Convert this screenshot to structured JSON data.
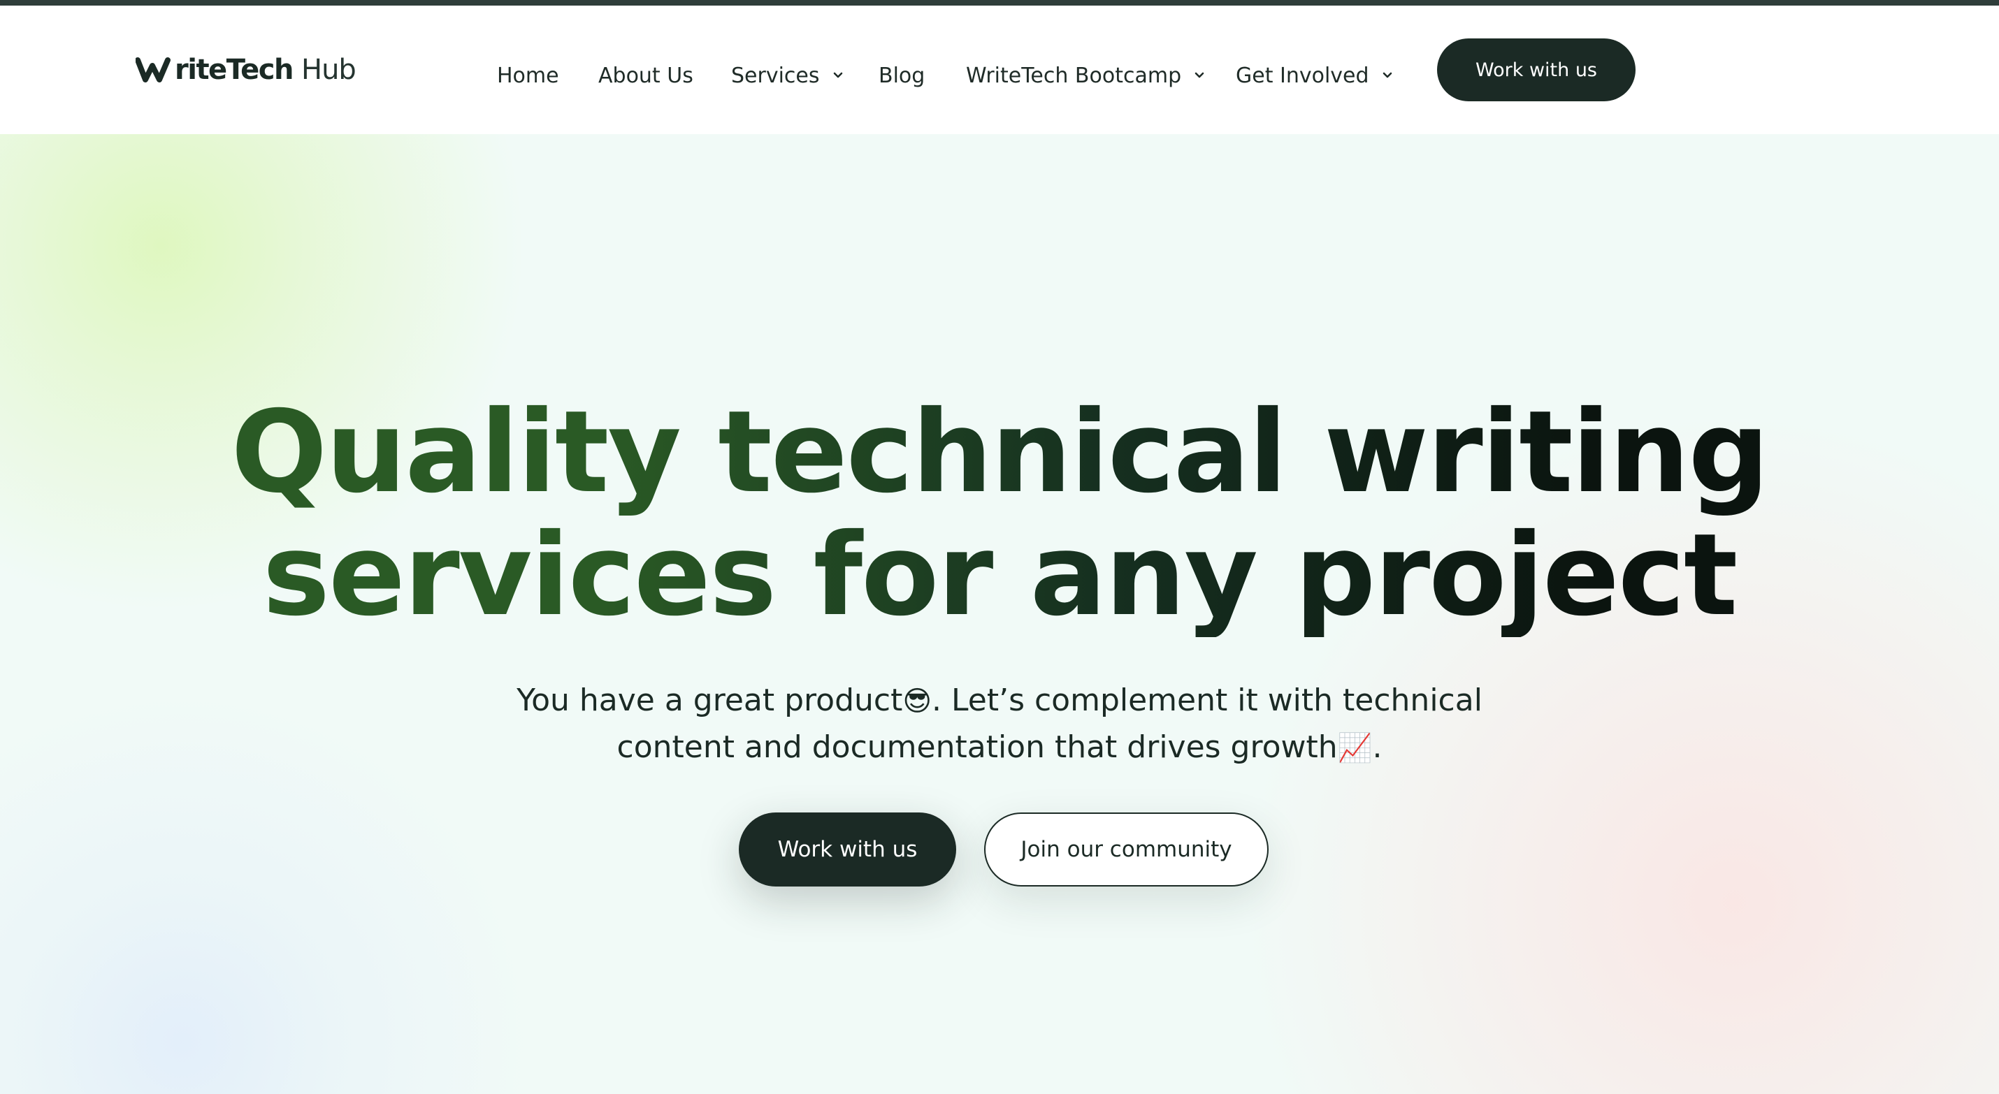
{
  "header": {
    "logo": {
      "strong": "riteTech",
      "light": "Hub"
    },
    "nav": [
      {
        "label": "Home",
        "has_dropdown": false
      },
      {
        "label": "About Us",
        "has_dropdown": false
      },
      {
        "label": "Services",
        "has_dropdown": true
      },
      {
        "label": "Blog",
        "has_dropdown": false
      },
      {
        "label": "WriteTech Bootcamp",
        "has_dropdown": true
      },
      {
        "label": "Get Involved",
        "has_dropdown": true
      }
    ],
    "cta_label": "Work with us"
  },
  "hero": {
    "title_line1": "Quality technical writing",
    "title_line2": "services for any project",
    "sub_line1_a": "You have a great product",
    "sub_line1_emoji": "😎",
    "sub_line1_b": ". Let’s complement it with technical",
    "sub_line2_a": "content and documentation that drives growth",
    "sub_line2_emoji": "📈",
    "sub_line2_b": ".",
    "primary_button": "Work with us",
    "secondary_button": "Join our community"
  },
  "colors": {
    "brand_dark": "#1b2a25",
    "title_green": "#2a5a25",
    "top_bar": "#2f3e3b"
  }
}
